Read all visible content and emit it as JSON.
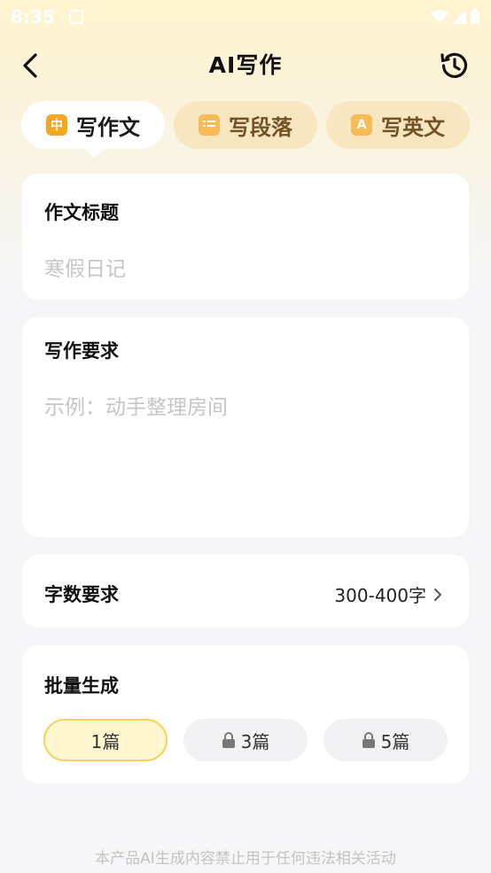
{
  "status_bar": {
    "time": "8:35"
  },
  "header": {
    "title": "AI写作"
  },
  "tabs": [
    {
      "label": "写作文",
      "icon_text": "中",
      "active": true
    },
    {
      "label": "写段落",
      "icon_text": "",
      "active": false
    },
    {
      "label": "写英文",
      "icon_text": "A",
      "active": false
    }
  ],
  "essay_title": {
    "label": "作文标题",
    "placeholder": "寒假日记"
  },
  "requirements": {
    "label": "写作要求",
    "placeholder": "示例：动手整理房间"
  },
  "word_count": {
    "label": "字数要求",
    "value": "300-400字"
  },
  "batch": {
    "label": "批量生成",
    "options": [
      {
        "label": "1篇",
        "locked": false,
        "selected": true
      },
      {
        "label": "3篇",
        "locked": true,
        "selected": false
      },
      {
        "label": "5篇",
        "locked": true,
        "selected": false
      }
    ]
  },
  "footer": {
    "notice": "本产品AI生成内容禁止用于任何违法相关活动"
  },
  "colors": {
    "accent": "#f5a623",
    "selected_bg": "#fff7cf",
    "selected_border": "#f6d45a"
  }
}
